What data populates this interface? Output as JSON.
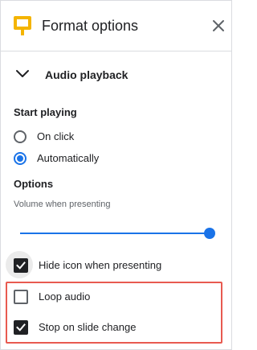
{
  "panel": {
    "title": "Format options",
    "close_icon": "close-icon",
    "app_icon": "slides-icon",
    "accent_color": "#1a73e8",
    "highlight_color": "#e85a50"
  },
  "section": {
    "title": "Audio playback",
    "expanded": true
  },
  "start_playing": {
    "label": "Start playing",
    "options": [
      {
        "label": "On click",
        "selected": false
      },
      {
        "label": "Automatically",
        "selected": true
      }
    ]
  },
  "options": {
    "label": "Options",
    "volume_label": "Volume when presenting",
    "volume_value": 1.0,
    "checkboxes": [
      {
        "label": "Hide icon when presenting",
        "checked": true
      },
      {
        "label": "Loop audio",
        "checked": false
      },
      {
        "label": "Stop on slide change",
        "checked": true
      }
    ]
  }
}
